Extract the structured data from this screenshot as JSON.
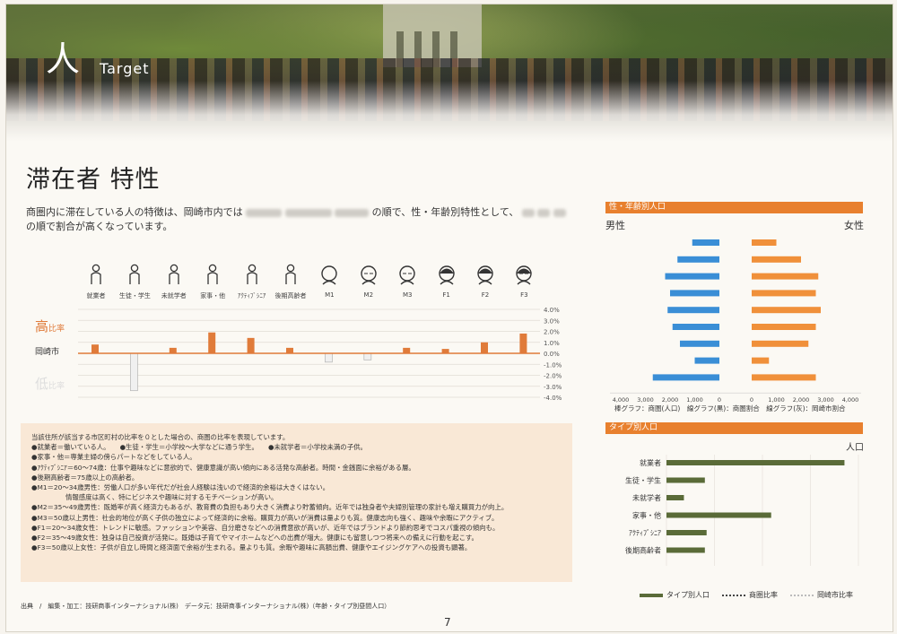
{
  "header": {
    "brand_mark": "人",
    "brand_text": "Target"
  },
  "title": "滞在者 特性",
  "intro": {
    "line1_pre": "商圏内に滞在している人の特徴は、岡崎市内では",
    "line1_post": "の順で、性・年齢別特性として、",
    "line2": "の順で割合が高くなっています。"
  },
  "icons": [
    {
      "name": "worker-icon",
      "label": "就業者"
    },
    {
      "name": "student-icon",
      "label": "生徒・学生"
    },
    {
      "name": "preschool-child-icon",
      "label": "未就学者"
    },
    {
      "name": "homemaker-icon",
      "label": "家事・他"
    },
    {
      "name": "active-senior-icon",
      "label": "ｱｸﾃｨﾌﾞｼﾆｱ"
    },
    {
      "name": "late-elderly-icon",
      "label": "後期高齢者"
    },
    {
      "name": "m1-icon",
      "label": "M1"
    },
    {
      "name": "m2-icon",
      "label": "M2"
    },
    {
      "name": "m3-icon",
      "label": "M3"
    },
    {
      "name": "f1-icon",
      "label": "F1"
    },
    {
      "name": "f2-icon",
      "label": "F2"
    },
    {
      "name": "f3-icon",
      "label": "F3"
    }
  ],
  "axis_labels": {
    "high": "高",
    "high_suffix": "比率",
    "mid": "岡崎市",
    "low": "低",
    "low_suffix": "比率"
  },
  "chart_data": [
    {
      "type": "bar",
      "categories": [
        "就業者",
        "生徒・学生",
        "未就学者",
        "家事・他",
        "ｱｸﾃｨﾌﾞｼﾆｱ",
        "後期高齢者",
        "M1",
        "M2",
        "M3",
        "F1",
        "F2",
        "F3"
      ],
      "values": [
        0.8,
        -3.4,
        0.5,
        1.9,
        1.4,
        0.5,
        -0.8,
        -0.6,
        0.5,
        0.4,
        1.0,
        1.8
      ],
      "y_ticks": [
        "4.0%",
        "3.0%",
        "2.0%",
        "1.0%",
        "0.0%",
        "-1.0%",
        "-2.0%",
        "-3.0%",
        "-4.0%"
      ],
      "ylim": [
        -4.0,
        4.0
      ],
      "colors": {
        "positive": "#e07b3a",
        "negative": "#f0f0f0",
        "baseline": "#e07b3a"
      }
    },
    {
      "type": "bar",
      "title": "性・年齢別人口",
      "left_label": "男性",
      "right_label": "女性",
      "x_ticks": [
        "4,000",
        "3,000",
        "2,000",
        "1,000",
        "0",
        "0",
        "1,000",
        "2,000",
        "3,000",
        "4,000"
      ],
      "male_values": [
        1100,
        1700,
        2200,
        2000,
        2100,
        1900,
        1600,
        1000,
        2700
      ],
      "female_values": [
        1000,
        2000,
        2700,
        2600,
        2800,
        2600,
        2300,
        700,
        2600
      ],
      "male_color": "#3a8ed6",
      "female_color": "#f0903a",
      "note": "棒グラフ：商圏(人口)　線グラフ(黒)：商圏割合　線グラフ(灰)：岡崎市割合"
    },
    {
      "type": "bar",
      "title": "タイプ別人口",
      "unit": "人口",
      "categories": [
        "就業者",
        "生徒・学生",
        "未就学者",
        "家事・他",
        "ｱｸﾃｨﾌﾞｼﾆｱ",
        "後期高齢者"
      ],
      "values": [
        10200,
        2200,
        1000,
        6000,
        2300,
        2200
      ],
      "xlim": [
        0,
        11000
      ],
      "bar_color": "#5a6b38",
      "legend": [
        "タイプ別人口",
        "商圏比率",
        "岡崎市比率"
      ]
    }
  ],
  "notes": [
    "当該住所が該当する市区町村の比率を０とした場合の、商圏の比率を表現しています。",
    "●就業者＝働いている人。　　●生徒・学生＝小学校～大学などに通う学生。　　●未就学者＝小学校未満の子供。",
    "●家事・他＝専業主婦の傍らパートなどをしている人。",
    "●ｱｸﾃｨﾌﾞｼﾆｱ＝60～74歳：仕事や趣味などに意欲的で、健康意識が高い傾向にある活発な高齢者。時間・金銭面に余裕がある層。",
    "●後期高齢者＝75歳以上の高齢者。",
    "●M1＝20～34歳男性：労働人口が多い年代だが社会人経験は浅いので経済的余裕は大きくはない。",
    "情報感度は高く、特にビジネスや趣味に対するモチベーションが高い。",
    "●M2＝35～49歳男性：既婚率が高く経済力もあるが、教育費の負担もあり大きく消費より貯蓄傾向。近年では独身者や夫婦別管理の家計も増え購買力が向上。",
    "●M3＝50歳以上男性：社会的地位が高く子供の独立によって経済的に余裕。購買力が高いが消費は量よりも質。健康志向も強く、趣味や余暇にアクティブ。",
    "●F1＝20～34歳女性：トレンドに敏感。ファッションや美容、自分磨きなどへの消費意欲が高いが、近年ではブランドより節約思考でコスパ重視の傾向も。",
    "●F2＝35～49歳女性：独身は自己投資が活発に。既婚は子育てやマイホームなどへの出費が増大。健康にも留意しつつ将来への備えに行動を起こす。",
    "●F3＝50歳以上女性：子供が自立し時間と経済面で余裕が生まれる。量よりも質。余暇や趣味に高額出費、健康やエイジングケアへの投資も顕著。"
  ],
  "source": "出典　/　編集・加工：技研商事インターナショナル(株)　データ元：技研商事インターナショナル(株)（年齢・タイプ別昼間人口）",
  "page_number": "7"
}
